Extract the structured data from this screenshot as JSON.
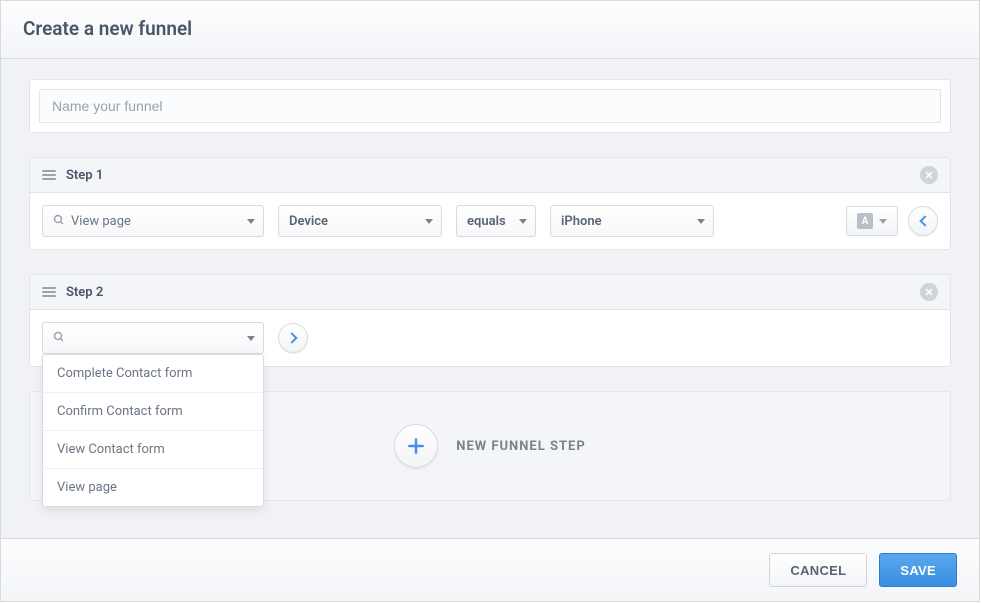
{
  "modal": {
    "title": "Create a new funnel",
    "name_placeholder": "Name your funnel",
    "cancel_label": "CANCEL",
    "save_label": "SAVE"
  },
  "step1": {
    "title": "Step 1",
    "event_label": "View page",
    "property_label": "Device",
    "operator_label": "equals",
    "value_label": "iPhone",
    "letter": "A"
  },
  "step2": {
    "title": "Step 2",
    "event_label": "",
    "options": [
      "Complete Contact form",
      "Confirm Contact form",
      "View Contact form",
      "View page"
    ]
  },
  "new_step": {
    "label": "NEW FUNNEL STEP"
  }
}
